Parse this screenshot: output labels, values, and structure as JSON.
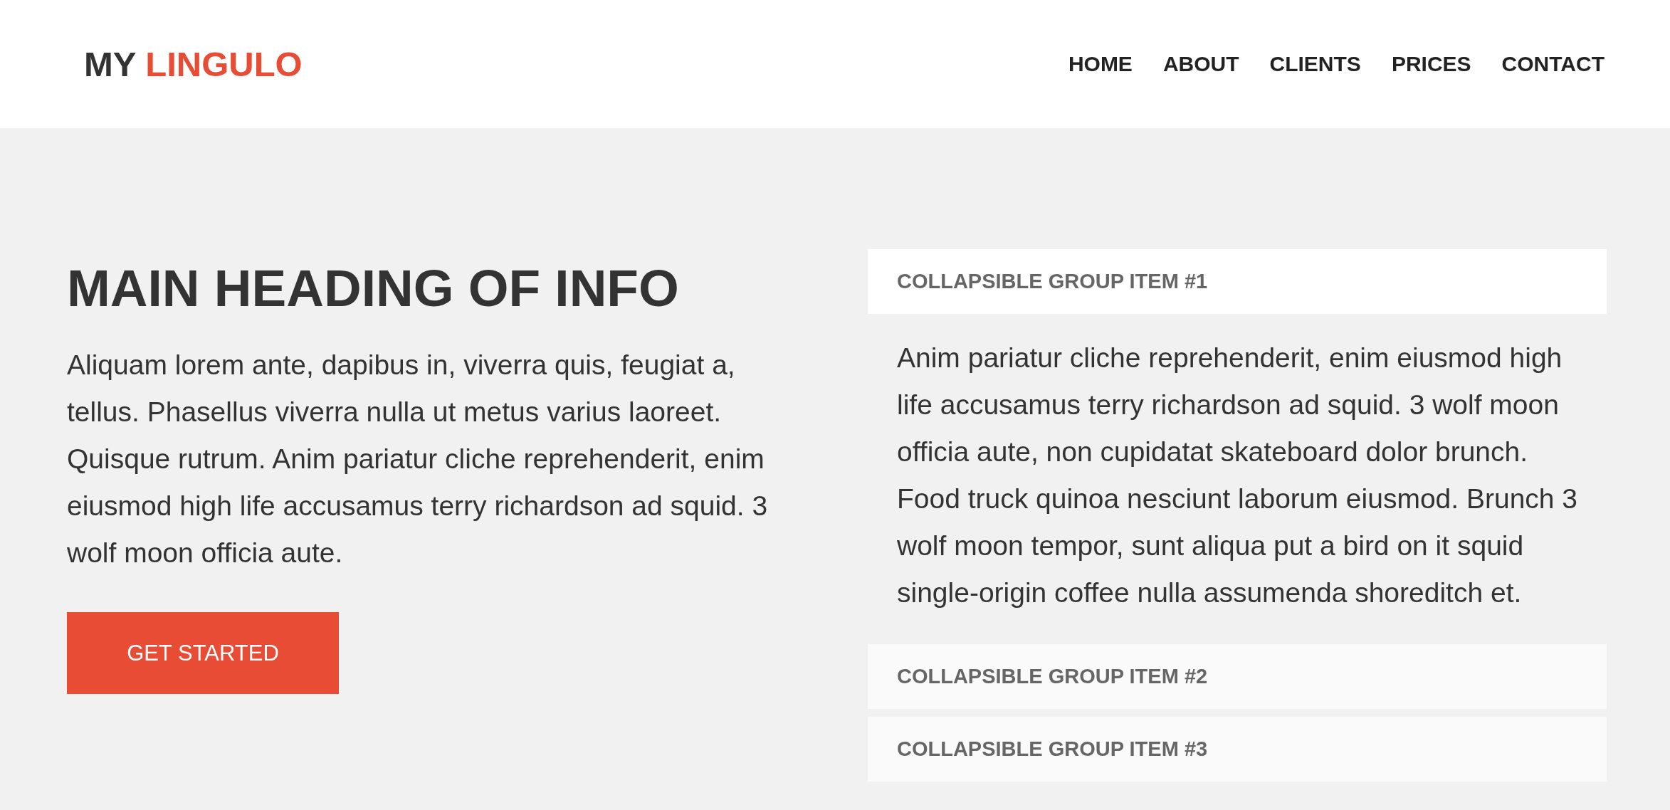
{
  "header": {
    "logo": {
      "prefix": "MY",
      "highlight": "LINGULO"
    },
    "nav": [
      "HOME",
      "ABOUT",
      "CLIENTS",
      "PRICES",
      "CONTACT"
    ]
  },
  "hero": {
    "heading": "MAIN HEADING OF INFO",
    "text": "Aliquam lorem ante, dapibus in, viverra quis, feugiat a, tellus. Phasellus viverra nulla ut metus varius laoreet. Quisque rutrum. Anim pariatur cliche reprehenderit, enim eiusmod high life accusamus terry richardson ad squid. 3 wolf moon officia aute.",
    "button": "GET STARTED"
  },
  "accordion": [
    {
      "title": "COLLAPSIBLE GROUP ITEM #1",
      "body": "Anim pariatur cliche reprehenderit, enim eiusmod high life accusamus terry richardson ad squid. 3 wolf moon officia aute, non cupidatat skateboard dolor brunch. Food truck quinoa nesciunt laborum eiusmod. Brunch 3 wolf moon tempor, sunt aliqua put a bird on it squid single-origin coffee nulla assumenda shoreditch et."
    },
    {
      "title": "COLLAPSIBLE GROUP ITEM #2"
    },
    {
      "title": "COLLAPSIBLE GROUP ITEM #3"
    }
  ]
}
